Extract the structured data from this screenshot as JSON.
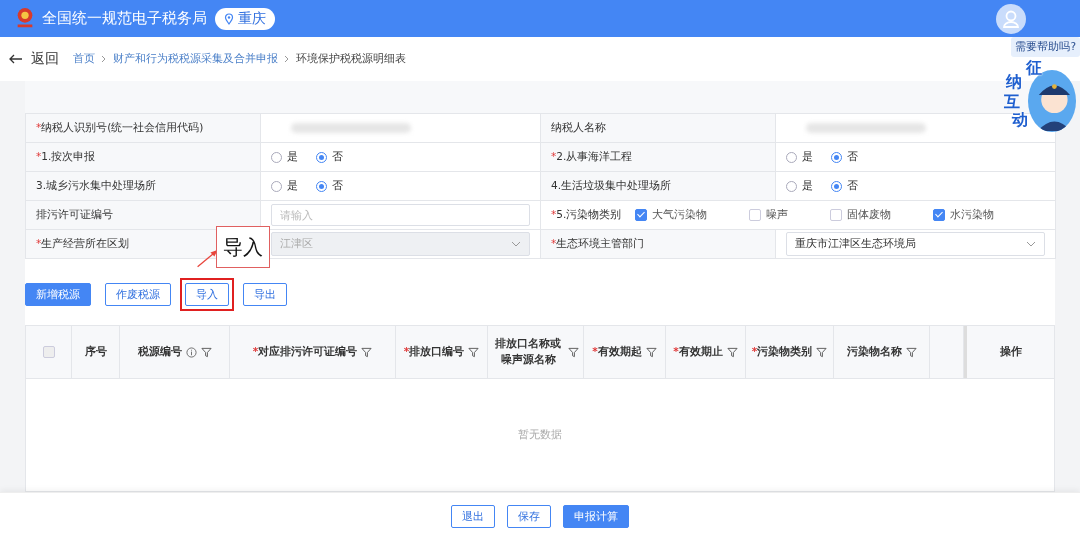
{
  "header": {
    "title": "全国统一规范电子税务局",
    "region": "重庆"
  },
  "nav": {
    "back": "返回",
    "breadcrumbs": [
      {
        "text": "首页",
        "link": true
      },
      {
        "text": "财产和行为税税源采集及合并申报",
        "link": true
      },
      {
        "text": "环境保护税税源明细表",
        "link": false
      }
    ]
  },
  "help": {
    "bubble": "需要帮助吗?",
    "mascot_chars": [
      "征",
      "纳",
      "互",
      "动"
    ]
  },
  "form": {
    "rows": [
      {
        "left": {
          "mark": "*",
          "label": "纳税人识别号(统一社会信用代码)",
          "kind": "text"
        },
        "right": {
          "label": "纳税人名称",
          "kind": "text"
        }
      },
      {
        "left": {
          "mark": "*",
          "label": "1.按次申报",
          "kind": "radio",
          "options": [
            {
              "text": "是",
              "selected": false
            },
            {
              "text": "否",
              "selected": true
            }
          ]
        },
        "right": {
          "mark": "*",
          "label": "2.从事海洋工程",
          "kind": "radio",
          "options": [
            {
              "text": "是",
              "selected": false
            },
            {
              "text": "否",
              "selected": true
            }
          ]
        }
      },
      {
        "left": {
          "label": "3.城乡污水集中处理场所",
          "kind": "radio",
          "options": [
            {
              "text": "是",
              "selected": false
            },
            {
              "text": "否",
              "selected": true
            }
          ]
        },
        "right": {
          "label": "4.生活垃圾集中处理场所",
          "kind": "radio",
          "options": [
            {
              "text": "是",
              "selected": false
            },
            {
              "text": "否",
              "selected": true
            }
          ]
        }
      },
      {
        "left": {
          "label": "排污许可证编号",
          "kind": "input",
          "placeholder": "请输入"
        },
        "right": {
          "mark": "*",
          "label": "5.污染物类别",
          "kind": "checks",
          "options": [
            {
              "text": "大气污染物",
              "checked": true
            },
            {
              "text": "噪声",
              "checked": false
            },
            {
              "text": "固体废物",
              "checked": false
            },
            {
              "text": "水污染物",
              "checked": true
            }
          ]
        }
      },
      {
        "left": {
          "mark": "*",
          "label": "生产经营所在区划",
          "kind": "select",
          "value": "江津区",
          "disabled": true
        },
        "right": {
          "mark": "*",
          "label": "生态环境主管部门",
          "kind": "select",
          "value": "重庆市江津区生态环境局",
          "disabled": false
        }
      }
    ]
  },
  "actions": [
    {
      "label": "新增税源",
      "primary": true,
      "highlighted": false
    },
    {
      "label": "作废税源",
      "primary": false,
      "highlighted": false
    },
    {
      "label": "导入",
      "primary": false,
      "highlighted": true
    },
    {
      "label": "导出",
      "primary": false,
      "highlighted": false
    }
  ],
  "annotation": {
    "text": "导入"
  },
  "table": {
    "columns": [
      {
        "kind": "check",
        "checked": false
      },
      {
        "label": "序号",
        "filter": false,
        "info": false
      },
      {
        "label": "税源编号",
        "filter": true,
        "info": true
      },
      {
        "mark": "*",
        "label": "对应排污许可证编号",
        "filter": true,
        "info": false
      },
      {
        "mark": "*",
        "label": "排放口编号",
        "filter": true,
        "info": false
      },
      {
        "label": "排放口名称或噪声源名称",
        "filter": true,
        "info": false
      },
      {
        "mark": "*",
        "label": "有效期起",
        "filter": true,
        "info": false
      },
      {
        "mark": "*",
        "label": "有效期止",
        "filter": true,
        "info": false
      },
      {
        "mark": "*",
        "label": "污染物类别",
        "filter": true,
        "info": false
      },
      {
        "label": "污染物名称",
        "filter": true,
        "info": false
      },
      {
        "kind": "blank"
      },
      {
        "label": "操作",
        "filter": false,
        "info": false,
        "kind": "fixed"
      }
    ],
    "empty": "暂无数据"
  },
  "footer": [
    {
      "label": "退出",
      "primary": false
    },
    {
      "label": "保存",
      "primary": false
    },
    {
      "label": "申报计算",
      "primary": true
    }
  ]
}
